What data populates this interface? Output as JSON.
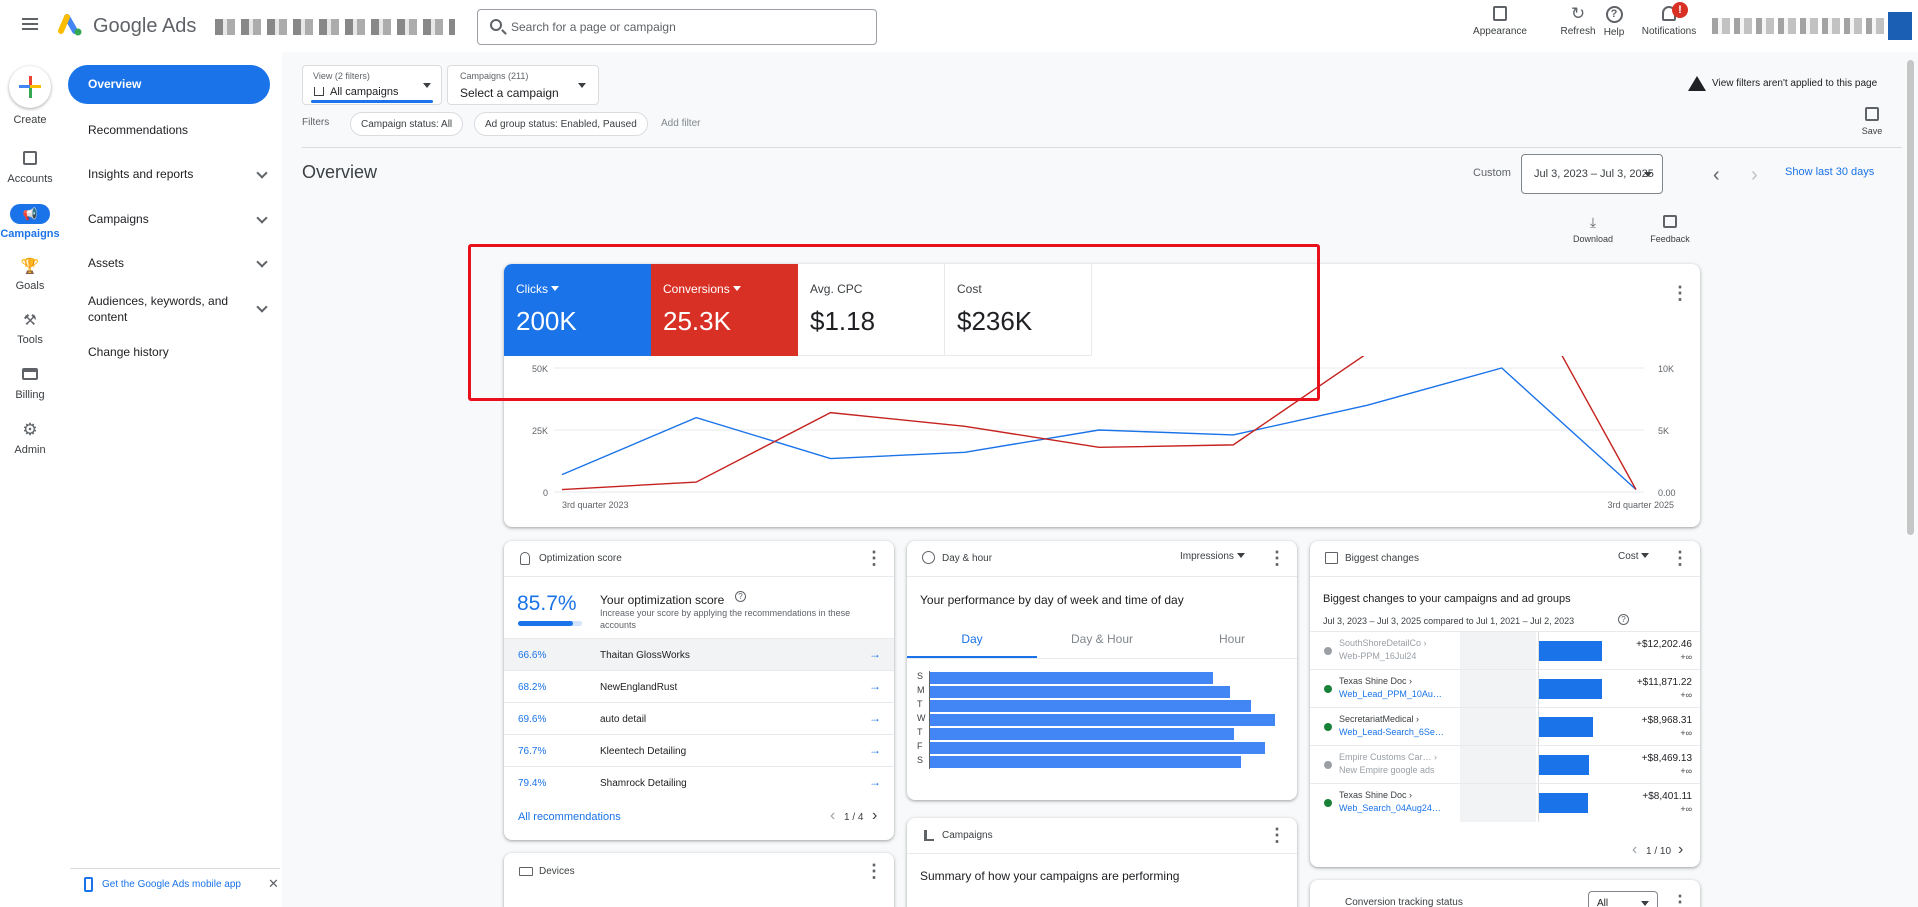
{
  "app": {
    "name": "Google Ads",
    "search_placeholder": "Search for a page or campaign"
  },
  "toolbar": {
    "appearance": "Appearance",
    "refresh": "Refresh",
    "help": "Help",
    "notifications": "Notifications",
    "notif_badge": "!"
  },
  "rail": {
    "create": "Create",
    "accounts": "Accounts",
    "campaigns": "Campaigns",
    "goals": "Goals",
    "tools": "Tools",
    "billing": "Billing",
    "admin": "Admin"
  },
  "nav": {
    "overview": "Overview",
    "recommendations": "Recommendations",
    "insights": "Insights and reports",
    "campaigns": "Campaigns",
    "assets": "Assets",
    "audiences_1": "Audiences, keywords, and",
    "audiences_2": "content",
    "change_history": "Change history",
    "mobile_app": "Get the Google Ads mobile app"
  },
  "filters": {
    "view_label": "View (2 filters)",
    "view_value": "All campaigns",
    "campaigns_label": "Campaigns (211)",
    "campaigns_value": "Select a campaign",
    "filters_label": "Filters",
    "chip1": "Campaign status: All",
    "chip2": "Ad group status: Enabled, Paused",
    "add_filter": "Add filter",
    "warning": "View filters aren't applied to this page",
    "save": "Save"
  },
  "page": {
    "title": "Overview",
    "custom": "Custom",
    "date_range": "Jul 3, 2023 – Jul 3, 2025",
    "show_last": "Show last 30 days",
    "download": "Download",
    "feedback": "Feedback"
  },
  "metrics": [
    {
      "label": "Clicks",
      "value": "200K",
      "color": "#1a73e8"
    },
    {
      "label": "Conversions",
      "value": "25.3K",
      "color": "#d93025"
    },
    {
      "label": "Avg. CPC",
      "value": "$1.18"
    },
    {
      "label": "Cost",
      "value": "$236K"
    }
  ],
  "chart_data": {
    "type": "line",
    "x": [
      "3rd quarter 2023",
      "",
      "",
      "",
      "",
      "",
      "",
      "",
      "",
      "3rd quarter 2025"
    ],
    "left_ticks": [
      "50K",
      "25K",
      "0"
    ],
    "right_ticks": [
      "10K",
      "5K",
      "0.00"
    ],
    "ylim_left": [
      0,
      50000
    ],
    "ylim_right": [
      0,
      10000
    ],
    "series": [
      {
        "name": "Clicks",
        "color": "#1a73e8",
        "axis": "left",
        "values": [
          7000,
          30000,
          13500,
          16000,
          25000,
          23000,
          35000,
          50000,
          1000
        ]
      },
      {
        "name": "Conversions",
        "color": "#c5221f",
        "axis": "right",
        "values": [
          200,
          800,
          6400,
          5300,
          3600,
          3800,
          11200,
          19800,
          200
        ]
      }
    ]
  },
  "opt": {
    "title": "Optimization score",
    "score": "85.7%",
    "score_fraction": 0.857,
    "heading": "Your optimization score",
    "desc1": "Increase your score by applying the recommendations in these",
    "desc2": "accounts",
    "all": "All recommendations",
    "pager": "1 / 4",
    "rows": [
      {
        "pct": "66.6%",
        "name": "Thaitan GlossWorks"
      },
      {
        "pct": "68.2%",
        "name": "NewEnglandRust"
      },
      {
        "pct": "69.6%",
        "name": "auto detail"
      },
      {
        "pct": "76.7%",
        "name": "Kleentech Detailing"
      },
      {
        "pct": "79.4%",
        "name": "Shamrock Detailing"
      }
    ]
  },
  "dayhour": {
    "title": "Day & hour",
    "metric": "Impressions",
    "heading": "Your performance by day of week and time of day",
    "tabs": [
      "Day",
      "Day & Hour",
      "Hour"
    ],
    "days": [
      "S",
      "M",
      "T",
      "W",
      "T",
      "F",
      "S"
    ],
    "values": [
      0.82,
      0.87,
      0.93,
      1.0,
      0.88,
      0.97,
      0.9
    ]
  },
  "changes": {
    "title": "Biggest changes",
    "metric": "Cost",
    "heading": "Biggest changes to your campaigns and ad groups",
    "sub": "Jul 3, 2023 – Jul 3, 2025 compared to Jul 1, 2021 – Jul 2, 2023",
    "pager": "1 / 10",
    "rows": [
      {
        "l1": "SouthShoreDetailCo ›",
        "l2": "Web-PPM_16Jul24",
        "amt": "+$12,202.46",
        "sub": "+∞",
        "status": "#9aa0a6",
        "muted": true,
        "bar": 1.0
      },
      {
        "l1": "Texas Shine Doc ›",
        "l2": "Web_Lead_PPM_10Au…",
        "amt": "+$11,871.22",
        "sub": "+∞",
        "status": "#188038",
        "muted": false,
        "bar": 1.0
      },
      {
        "l1": "SecretariatMedical ›",
        "l2": "Web_Lead-Search_6Se…",
        "amt": "+$8,968.31",
        "sub": "+∞",
        "status": "#188038",
        "muted": false,
        "bar": 0.86
      },
      {
        "l1": "Empire Customs Car… ›",
        "l2": "New Empire google ads",
        "amt": "+$8,469.13",
        "sub": "+∞",
        "status": "#9aa0a6",
        "muted": true,
        "bar": 0.8
      },
      {
        "l1": "Texas Shine Doc ›",
        "l2": "Web_Search_04Aug24…",
        "amt": "+$8,401.11",
        "sub": "+∞",
        "status": "#188038",
        "muted": false,
        "bar": 0.78
      }
    ]
  },
  "campaigns_card": {
    "title": "Campaigns",
    "heading": "Summary of how your campaigns are performing"
  },
  "devices": {
    "title": "Devices"
  },
  "conv": {
    "title": "Conversion tracking status",
    "filter": "All"
  }
}
